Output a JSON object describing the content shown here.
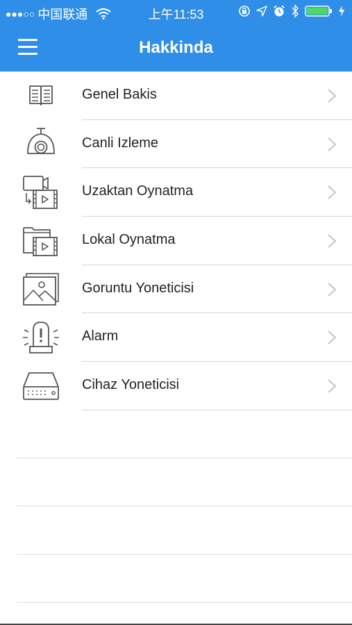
{
  "status_bar": {
    "signal": "●●●○○",
    "carrier": "中国联通",
    "time": "上午11:53",
    "icons": [
      "wifi-icon",
      "orientation-lock-icon",
      "location-icon",
      "alarm-icon",
      "bluetooth-icon",
      "battery-icon",
      "charging-icon"
    ]
  },
  "navbar": {
    "title": "Hakkinda",
    "menu_icon": "hamburger-menu-icon"
  },
  "menu": {
    "items": [
      {
        "label": "Genel Bakis",
        "icon": "book-icon"
      },
      {
        "label": "Canli Izleme",
        "icon": "camera-icon"
      },
      {
        "label": "Uzaktan Oynatma",
        "icon": "remote-playback-icon"
      },
      {
        "label": "Lokal Oynatma",
        "icon": "local-playback-icon"
      },
      {
        "label": "Goruntu Yoneticisi",
        "icon": "image-manager-icon"
      },
      {
        "label": "Alarm",
        "icon": "alarm-siren-icon"
      },
      {
        "label": "Cihaz Yoneticisi",
        "icon": "device-manager-icon"
      }
    ]
  },
  "colors": {
    "accent": "#2f8fe8",
    "text": "#222222",
    "icon": "#555555",
    "chevron": "#c4c4c4"
  }
}
